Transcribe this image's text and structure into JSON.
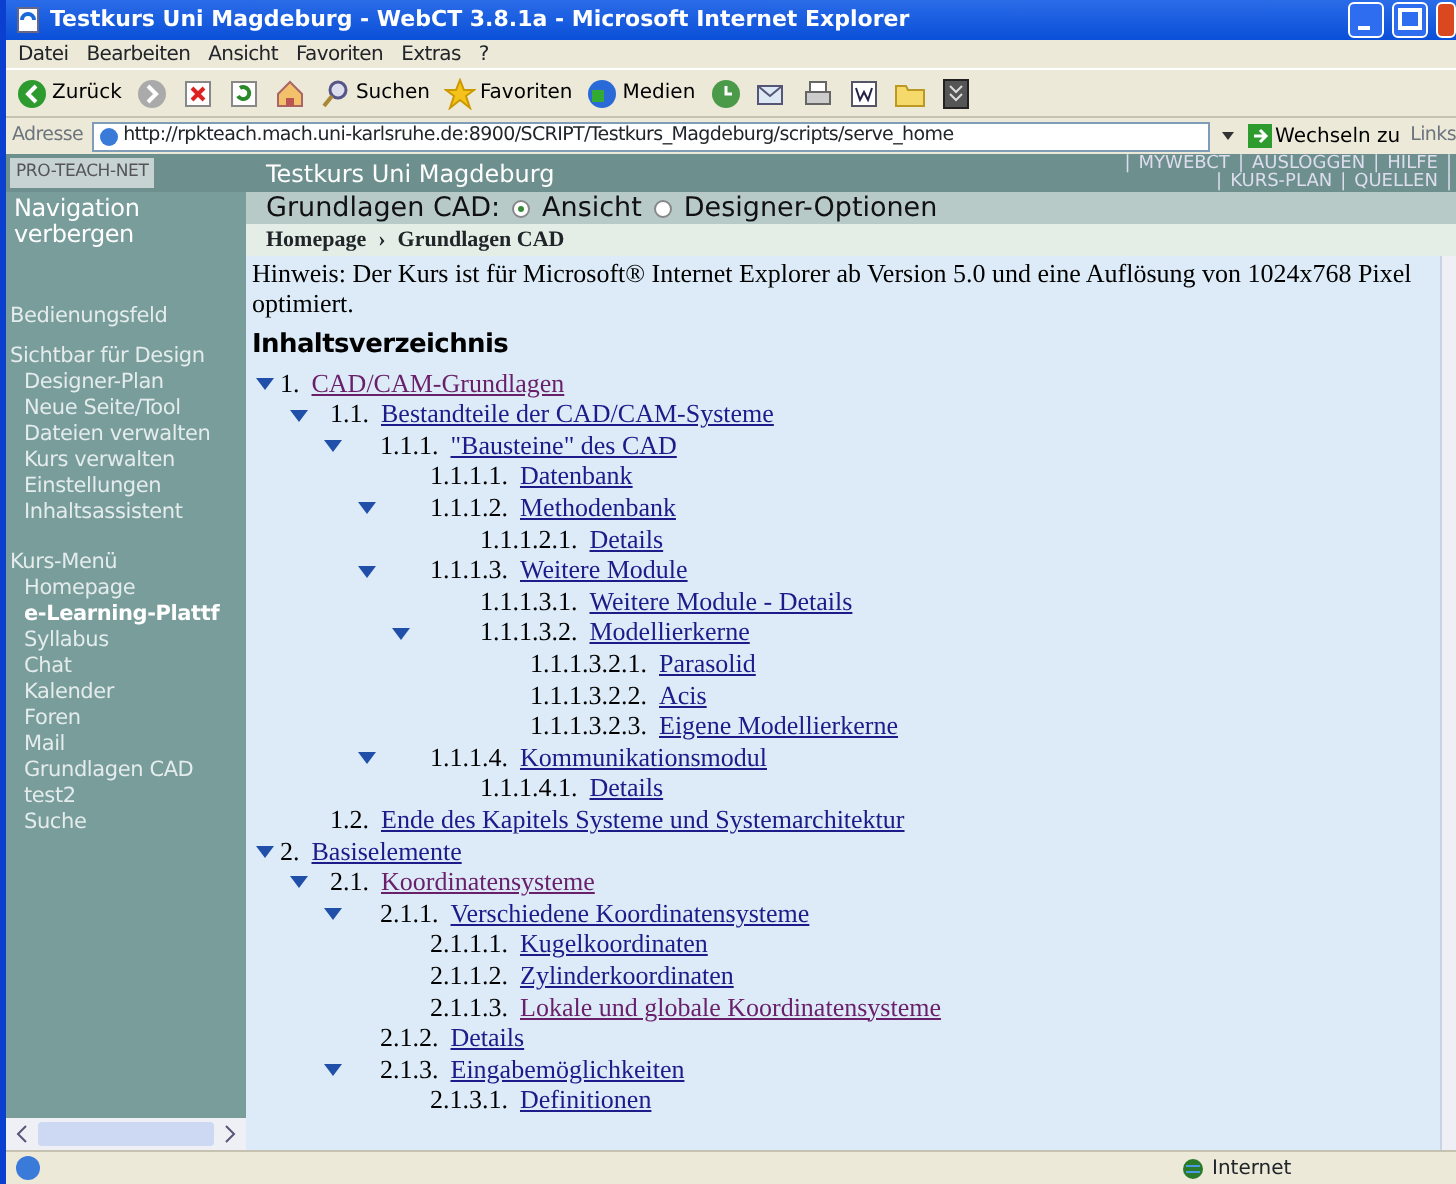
{
  "window": {
    "title": "Testkurs Uni Magdeburg - WebCT 3.8.1a - Microsoft Internet Explorer"
  },
  "menu": [
    "Datei",
    "Bearbeiten",
    "Ansicht",
    "Favoriten",
    "Extras",
    "?"
  ],
  "toolbar": [
    {
      "kind": "back",
      "label": "Zurück"
    },
    {
      "kind": "forward"
    },
    {
      "kind": "stop"
    },
    {
      "kind": "refresh"
    },
    {
      "kind": "home"
    },
    {
      "kind": "search",
      "label": "Suchen"
    },
    {
      "kind": "favorites",
      "label": "Favoriten"
    },
    {
      "kind": "media",
      "label": "Medien"
    },
    {
      "kind": "history"
    },
    {
      "kind": "mail"
    },
    {
      "kind": "print"
    },
    {
      "kind": "word"
    },
    {
      "kind": "folder"
    },
    {
      "kind": "tool"
    }
  ],
  "address": {
    "label": "Adresse",
    "url": "http://rpkteach.mach.uni-karlsruhe.de:8900/SCRIPT/Testkurs_Magdeburg/scripts/serve_home",
    "go": "Wechseln zu",
    "links": "Links"
  },
  "sidebar": {
    "logo": "PRO-TEACH-NET",
    "hide": "Navigation verbergen",
    "sections": [
      {
        "heading": "Bedienungsfeld"
      },
      {
        "heading": "Sichtbar für Design",
        "items": [
          {
            "label": "Designer-Plan",
            "selected": false
          },
          {
            "label": "Neue Seite/Tool",
            "selected": false
          },
          {
            "label": "Dateien verwalten",
            "selected": false
          },
          {
            "label": "Kurs verwalten",
            "selected": false
          },
          {
            "label": "Einstellungen",
            "selected": false
          },
          {
            "label": "Inhaltsassistent",
            "selected": false
          }
        ]
      },
      {
        "heading": "Kurs-Menü",
        "items": [
          {
            "label": "Homepage",
            "selected": false
          },
          {
            "label": "e-Learning-Plattf",
            "selected": true
          },
          {
            "label": "Syllabus",
            "selected": false
          },
          {
            "label": "Chat",
            "selected": false
          },
          {
            "label": "Kalender",
            "selected": false
          },
          {
            "label": "Foren",
            "selected": false
          },
          {
            "label": "Mail",
            "selected": false
          },
          {
            "label": "Grundlagen CAD",
            "selected": false
          },
          {
            "label": "test2",
            "selected": false
          },
          {
            "label": "Suche",
            "selected": false
          }
        ]
      }
    ]
  },
  "header": {
    "course": "Testkurs Uni Magdeburg",
    "separator": "|",
    "links": [
      [
        "MYWEBCT",
        "AUSLOGGEN",
        "HILFE"
      ],
      [
        "KURS-PLAN",
        "QUELLEN"
      ]
    ]
  },
  "view": {
    "label": "Grundlagen CAD:",
    "options": [
      {
        "label": "Ansicht",
        "selected": true
      },
      {
        "label": "Designer-Optionen",
        "selected": false
      }
    ]
  },
  "breadcrumb": {
    "items": [
      "Homepage",
      "Grundlagen CAD"
    ],
    "separator": "›"
  },
  "notice": "Hinweis: Der Kurs ist für Microsoft® Internet Explorer ab Version 5.0 und eine Auflösung von 1024x768 Pixel optimiert.",
  "toc_title": "Inhaltsverzeichnis",
  "toc": [
    {
      "number": "1.",
      "title": "CAD/CAM-Grundlagen",
      "visited": true,
      "expanded": true,
      "children": [
        {
          "number": "1.1.",
          "title": "Bestandteile der CAD/CAM-Systeme",
          "visited": false,
          "expanded": true,
          "children": [
            {
              "number": "1.1.1.",
              "title": "\"Bausteine\" des CAD",
              "visited": false,
              "expanded": true,
              "children": [
                {
                  "number": "1.1.1.1.",
                  "title": "Datenbank",
                  "visited": false,
                  "expanded": false
                },
                {
                  "number": "1.1.1.2.",
                  "title": "Methodenbank",
                  "visited": false,
                  "expanded": true,
                  "children": [
                    {
                      "number": "1.1.1.2.1.",
                      "title": "Details",
                      "visited": false,
                      "expanded": false
                    }
                  ]
                },
                {
                  "number": "1.1.1.3.",
                  "title": "Weitere Module",
                  "visited": false,
                  "expanded": true,
                  "children": [
                    {
                      "number": "1.1.1.3.1.",
                      "title": "Weitere Module - Details",
                      "visited": false,
                      "expanded": false
                    },
                    {
                      "number": "1.1.1.3.2.",
                      "title": "Modellierkerne",
                      "visited": false,
                      "expanded": true,
                      "children": [
                        {
                          "number": "1.1.1.3.2.1.",
                          "title": "Parasolid",
                          "visited": false,
                          "expanded": false
                        },
                        {
                          "number": "1.1.1.3.2.2.",
                          "title": "Acis",
                          "visited": false,
                          "expanded": false
                        },
                        {
                          "number": "1.1.1.3.2.3.",
                          "title": "Eigene Modellierkerne",
                          "visited": false,
                          "expanded": false
                        }
                      ]
                    }
                  ]
                },
                {
                  "number": "1.1.1.4.",
                  "title": "Kommunikationsmodul",
                  "visited": false,
                  "expanded": true,
                  "children": [
                    {
                      "number": "1.1.1.4.1.",
                      "title": "Details",
                      "visited": false,
                      "expanded": false
                    }
                  ]
                }
              ]
            }
          ]
        },
        {
          "number": "1.2.",
          "title": "Ende des Kapitels Systeme und Systemarchitektur",
          "visited": false,
          "expanded": false
        }
      ]
    },
    {
      "number": "2.",
      "title": "Basiselemente",
      "visited": false,
      "expanded": true,
      "children": [
        {
          "number": "2.1.",
          "title": "Koordinatensysteme",
          "visited": true,
          "expanded": true,
          "children": [
            {
              "number": "2.1.1.",
              "title": "Verschiedene Koordinatensysteme",
              "visited": false,
              "expanded": true,
              "children": [
                {
                  "number": "2.1.1.1.",
                  "title": "Kugelkoordinaten",
                  "visited": false,
                  "expanded": false
                },
                {
                  "number": "2.1.1.2.",
                  "title": "Zylinderkoordinaten",
                  "visited": false,
                  "expanded": false
                },
                {
                  "number": "2.1.1.3.",
                  "title": "Lokale und globale Koordinatensysteme",
                  "visited": true,
                  "expanded": false
                }
              ]
            },
            {
              "number": "2.1.2.",
              "title": "Details",
              "visited": false,
              "expanded": false
            },
            {
              "number": "2.1.3.",
              "title": "Eingabemöglichkeiten",
              "visited": false,
              "expanded": true,
              "children": [
                {
                  "number": "2.1.3.1.",
                  "title": "Definitionen",
                  "visited": false,
                  "expanded": false
                }
              ]
            }
          ]
        }
      ]
    }
  ],
  "status": {
    "zone": "Internet"
  }
}
